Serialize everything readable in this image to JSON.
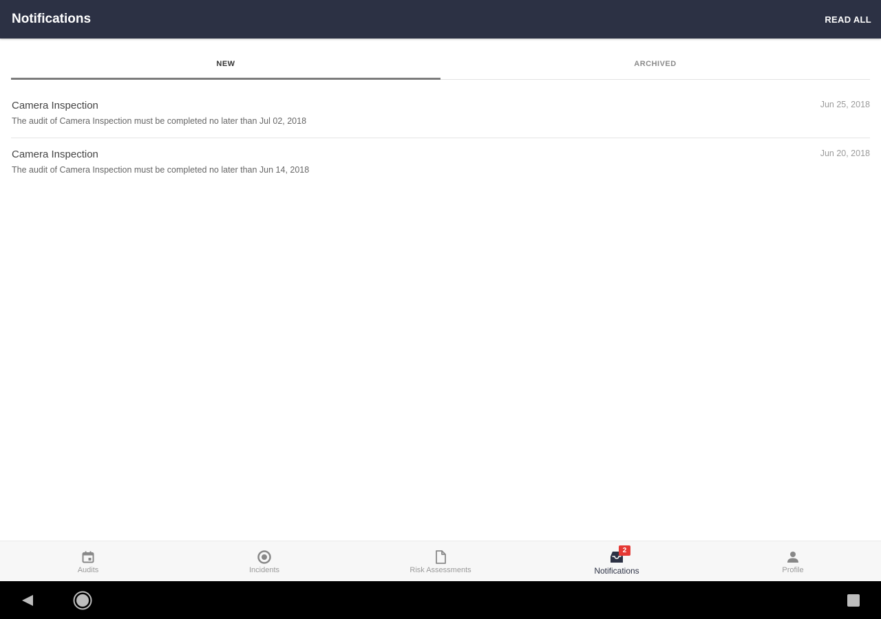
{
  "appbar": {
    "title": "Notifications",
    "action": "READ ALL"
  },
  "tabs": [
    {
      "label": "NEW",
      "active": true
    },
    {
      "label": "ARCHIVED",
      "active": false
    }
  ],
  "notifications": [
    {
      "title": "Camera Inspection",
      "body": "The audit of Camera Inspection must be completed no later than Jul 02, 2018",
      "date": "Jun 25, 2018"
    },
    {
      "title": "Camera Inspection",
      "body": "The audit of Camera Inspection must be completed no later than Jun 14, 2018",
      "date": "Jun 20, 2018"
    }
  ],
  "bottom_nav": {
    "items": [
      {
        "label": "Audits",
        "icon": "calendar-icon",
        "active": false
      },
      {
        "label": "Incidents",
        "icon": "incident-icon",
        "active": false
      },
      {
        "label": "Risk Assessments",
        "icon": "document-icon",
        "active": false
      },
      {
        "label": "Notifications",
        "icon": "inbox-icon",
        "active": true,
        "badge": "2"
      },
      {
        "label": "Profile",
        "icon": "person-icon",
        "active": false
      }
    ]
  },
  "colors": {
    "appbar_bg": "#2c3144",
    "badge": "#e53935",
    "active_nav": "#2c3144",
    "inactive_text": "#9a9a9a"
  }
}
